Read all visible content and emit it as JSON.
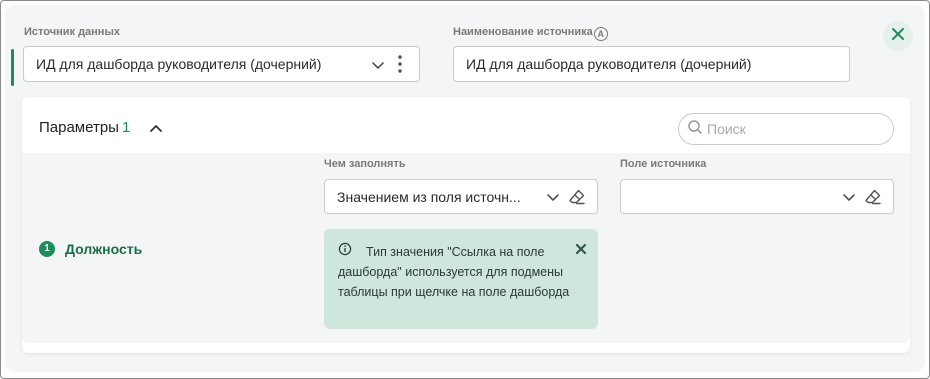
{
  "data_source": {
    "label": "Источник данных",
    "value": "ИД для дашборда руководителя (дочерний)"
  },
  "source_name": {
    "label": "Наименование источника",
    "label_badge": "A",
    "value": "ИД для дашборда руководителя (дочерний)"
  },
  "parameters": {
    "title": "Параметры",
    "count": "1",
    "search_placeholder": "Поиск",
    "columns": {
      "fill_with": "Чем заполнять",
      "source_field": "Поле источника"
    },
    "rows": [
      {
        "number": "1",
        "name": "Должность",
        "fill_with_value": "Значением из поля источн...",
        "source_field_value": ""
      }
    ],
    "notice": {
      "text": "Тип значения \"Ссылка на поле дашборда\" используется для подмены таблицы при щелчке на поле дашборда"
    }
  },
  "colors": {
    "accent": "#1e8c5a",
    "notice_bg": "#cfe6dc"
  },
  "icons": [
    "chevron-down-icon",
    "kebab-menu-icon",
    "close-icon",
    "chevron-up-icon",
    "search-icon",
    "eraser-icon",
    "info-icon"
  ]
}
